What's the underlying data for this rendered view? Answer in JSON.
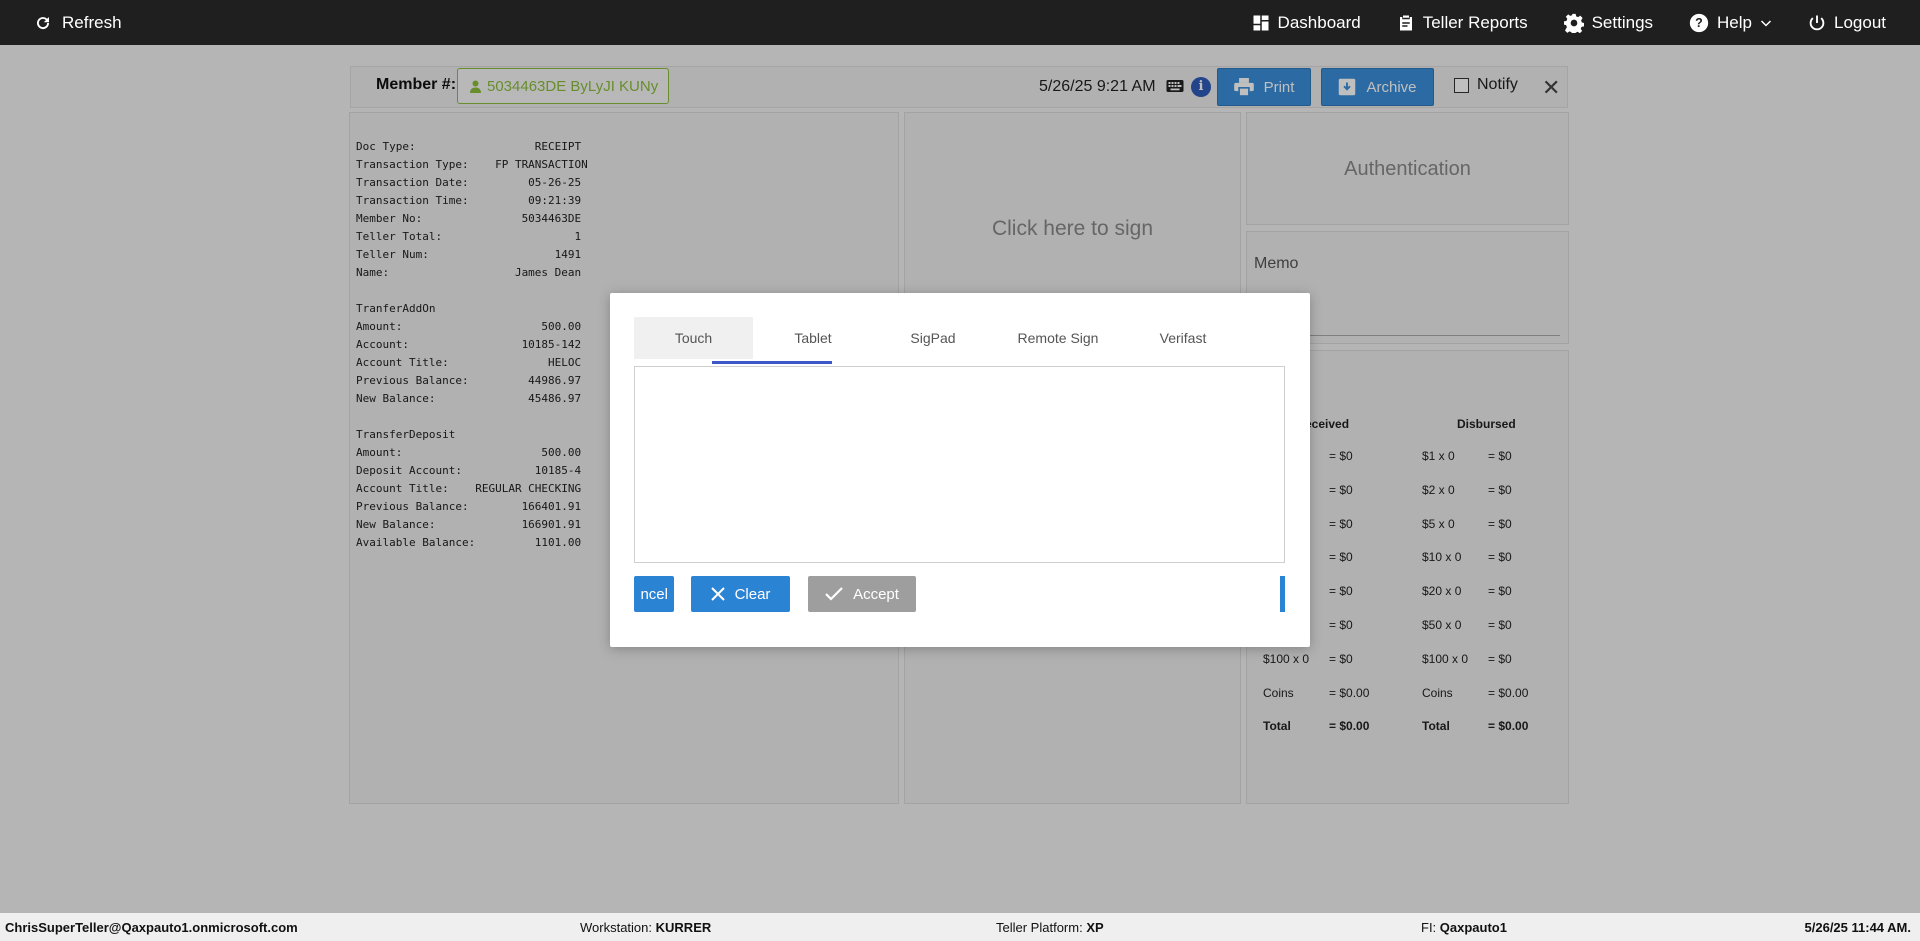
{
  "topbar": {
    "refresh_label": "Refresh",
    "nav": {
      "dashboard": "Dashboard",
      "teller_reports": "Teller Reports",
      "settings": "Settings",
      "help": "Help",
      "logout": "Logout"
    }
  },
  "toolbar": {
    "member_label": "Member #:",
    "member_value": "5034463DE ByLyJI KUNy",
    "datetime": "5/26/25 9:21 AM",
    "print_label": "Print",
    "archive_label": "Archive",
    "notify_label": "Notify"
  },
  "receipt_text": "Doc Type:                  RECEIPT\nTransaction Type:    FP TRANSACTION\nTransaction Date:         05-26-25\nTransaction Time:         09:21:39\nMember No:               5034463DE\nTeller Total:                    1\nTeller Num:                   1491\nName:                   James Dean\n\nTranferAddOn\nAmount:                     500.00\nAccount:                 10185-142\nAccount Title:               HELOC\nPrevious Balance:         44986.97\nNew Balance:              45486.97\n\nTransferDeposit\nAmount:                     500.00\nDeposit Account:           10185-4\nAccount Title:    REGULAR CHECKING\nPrevious Balance:        166401.91\nNew Balance:             166901.91\nAvailable Balance:         1101.00",
  "sign_panel": {
    "click_to_sign": "Click here to sign"
  },
  "auth_panel": {
    "title": "Authentication"
  },
  "memo_panel": {
    "title": "Memo"
  },
  "cash": {
    "received_header": "eceived",
    "disbursed_header": "Disbursed",
    "received_rows": [
      {
        "label": "",
        "value": "= $0"
      },
      {
        "label": "",
        "value": "= $0"
      },
      {
        "label": "",
        "value": "= $0"
      },
      {
        "label": "",
        "value": "= $0"
      },
      {
        "label": "",
        "value": "= $0"
      },
      {
        "label": "",
        "value": "= $0"
      },
      {
        "label": "$100 x 0",
        "value": "= $0"
      },
      {
        "label": "Coins",
        "value": "= $0.00"
      },
      {
        "label": "Total",
        "value": "= $0.00"
      }
    ],
    "disbursed_rows": [
      {
        "label": "$1 x 0",
        "value": "= $0"
      },
      {
        "label": "$2 x 0",
        "value": "= $0"
      },
      {
        "label": "$5 x 0",
        "value": "= $0"
      },
      {
        "label": "$10 x 0",
        "value": "= $0"
      },
      {
        "label": "$20 x 0",
        "value": "= $0"
      },
      {
        "label": "$50 x 0",
        "value": "= $0"
      },
      {
        "label": "$100 x 0",
        "value": "= $0"
      },
      {
        "label": "Coins",
        "value": "= $0.00"
      },
      {
        "label": "Total",
        "value": "= $0.00"
      }
    ]
  },
  "dialog": {
    "tabs": [
      "Touch",
      "Tablet",
      "SigPad",
      "Remote Sign",
      "Verifast"
    ],
    "active_tab": "Tablet",
    "cancel_label": "ncel",
    "clear_label": "Clear",
    "accept_label": "Accept"
  },
  "statusbar": {
    "user": "ChrisSuperTeller@Qaxpauto1.onmicrosoft.com",
    "workstation_label": "Workstation:",
    "workstation_value": "KURRER",
    "platform_label": "Teller Platform:",
    "platform_value": "XP",
    "fi_label": "FI:",
    "fi_value": "Qaxpauto1",
    "datetime": "5/26/25 11:44 AM."
  },
  "colors": {
    "topbar": "#1f1f1f",
    "primary_button": "#3a8ed8",
    "member_chip": "#8bbd3c",
    "tab_underline": "#3d56c8",
    "accept_disabled": "#9e9e9e"
  }
}
